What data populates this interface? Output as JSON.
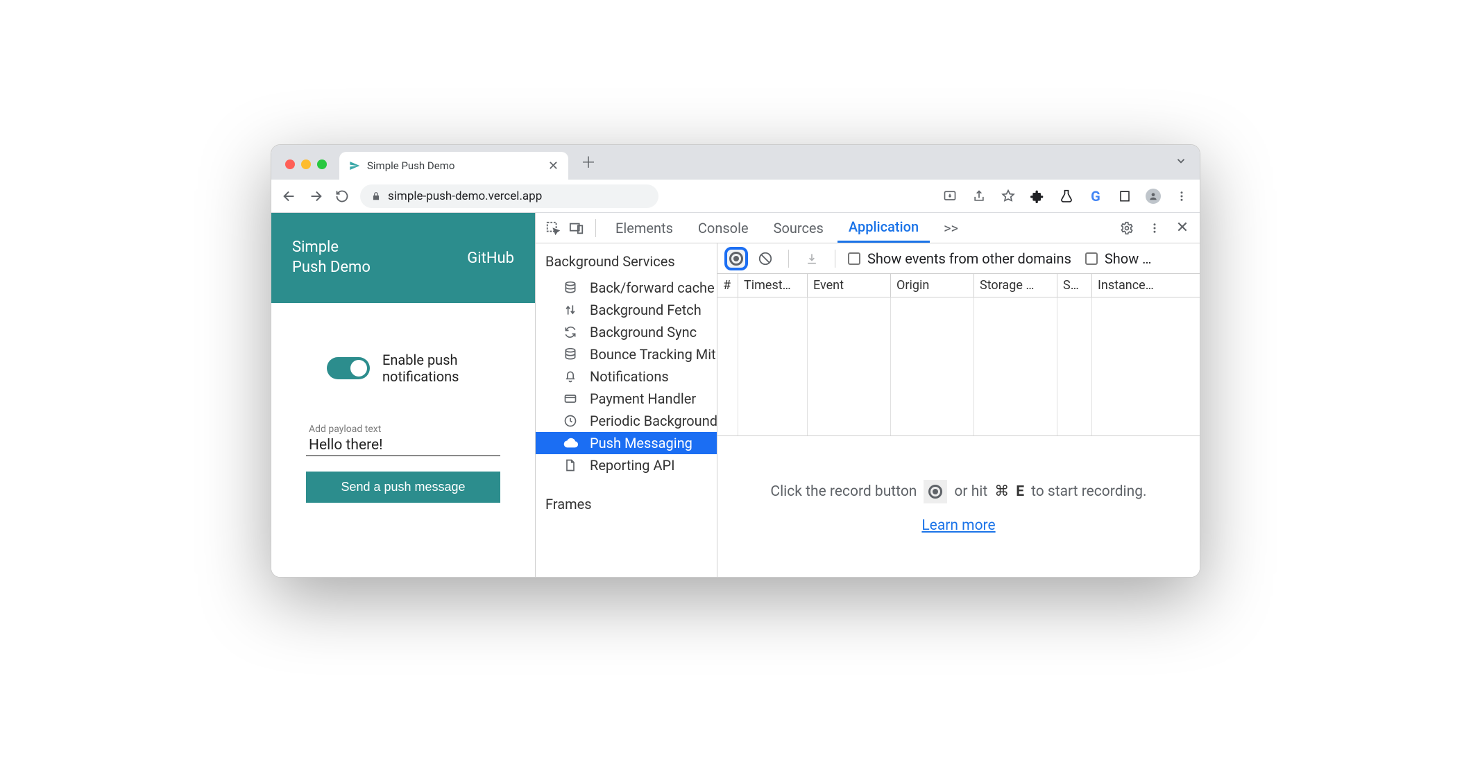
{
  "browser": {
    "tab_title": "Simple Push Demo",
    "url": "simple-push-demo.vercel.app"
  },
  "page": {
    "title_line1": "Simple",
    "title_line2": "Push Demo",
    "github": "GitHub",
    "toggle_label_line1": "Enable push",
    "toggle_label_line2": "notifications",
    "payload_label": "Add payload text",
    "payload_value": "Hello there!",
    "send_button": "Send a push message"
  },
  "devtools": {
    "tabs": [
      "Elements",
      "Console",
      "Sources",
      "Application"
    ],
    "active_tab": "Application",
    "more": ">>",
    "sidebar": {
      "category": "Background Services",
      "items": [
        {
          "label": "Back/forward cache"
        },
        {
          "label": "Background Fetch"
        },
        {
          "label": "Background Sync"
        },
        {
          "label": "Bounce Tracking Mitigation"
        },
        {
          "label": "Notifications"
        },
        {
          "label": "Payment Handler"
        },
        {
          "label": "Periodic Background Sync"
        },
        {
          "label": "Push Messaging"
        },
        {
          "label": "Reporting API"
        }
      ],
      "selected_index": 7,
      "category2": "Frames"
    },
    "toolbar": {
      "show_other_domains": "Show events from other domains",
      "show_truncated": "Show …"
    },
    "columns": [
      "#",
      "Timest…",
      "Event",
      "Origin",
      "Storage …",
      "S…",
      "Instance…"
    ],
    "hint_prefix": "Click the record button",
    "hint_middle": "or hit",
    "hint_key1": "⌘",
    "hint_key2": "E",
    "hint_suffix": "to start recording.",
    "learn_more": "Learn more"
  }
}
